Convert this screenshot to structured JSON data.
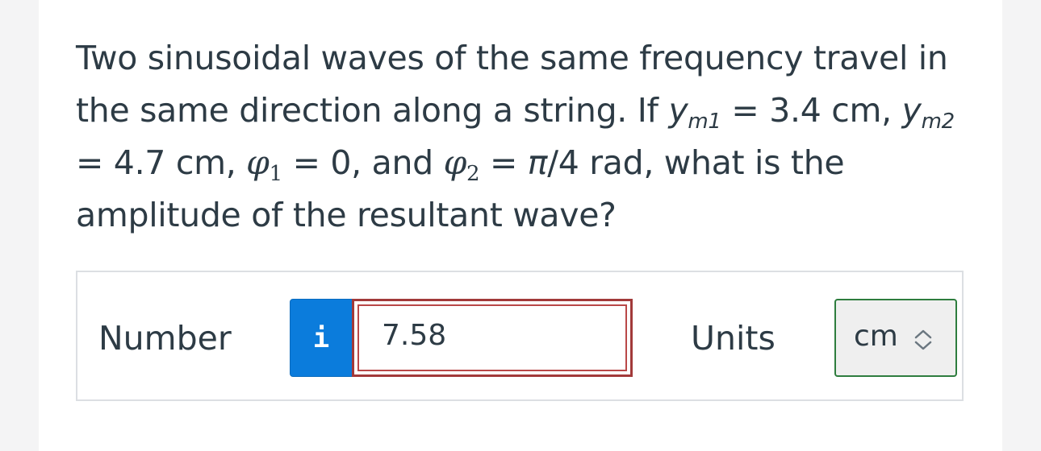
{
  "question": {
    "p1": "Two sinusoidal waves of the same frequency travel in the same direction along a string. If ",
    "y": "y",
    "m1": "m1",
    "p2": " = 3.4 cm, ",
    "m2": "m2",
    "p3": " = 4.7 cm, ",
    "phi": "φ",
    "sub1": "1",
    "p4": " = 0, and ",
    "sub2": "2",
    "p5": " = ",
    "pi": "π",
    "p6": "/4 rad, what is the amplitude of the resultant wave?"
  },
  "answer": {
    "number_label": "Number",
    "info_icon": "i",
    "number_value": "7.58",
    "units_label": "Units",
    "unit_selected": "cm"
  },
  "colors": {
    "info_button": "#0b7cdc",
    "input_error_border": "#a23a3a",
    "select_border": "#2e7d3e"
  }
}
